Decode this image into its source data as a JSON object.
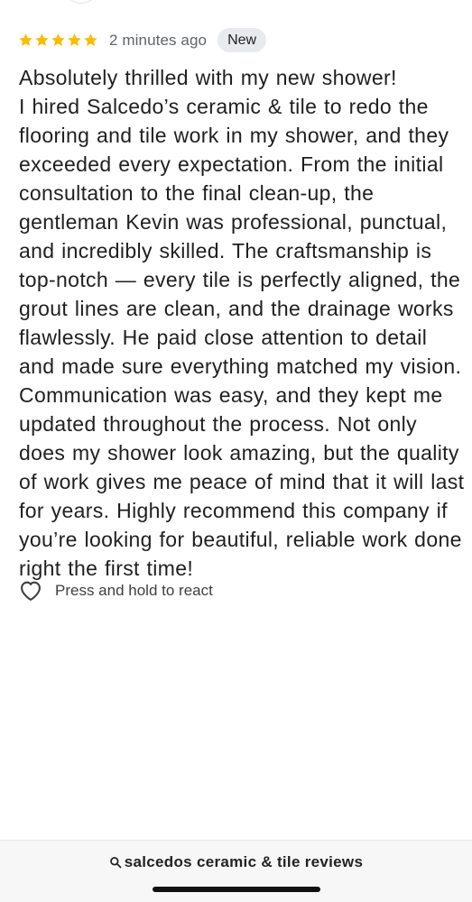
{
  "review": {
    "rating": 5,
    "rating_max": 5,
    "time": "2 minutes ago",
    "badge": "New",
    "paragraphs": [
      "Absolutely thrilled with my new shower!",
      "I hired Salcedo’s ceramic & tile to redo the flooring and tile work in my shower, and they exceeded every expectation. From the initial consultation to the final clean-up, the gentleman Kevin was professional, punctual, and incredibly skilled. The craftsmanship is top-notch — every tile is perfectly aligned, the grout lines are clean, and the drainage works flawlessly. He paid close attention to detail and made sure everything matched my vision.",
      "Communication was easy, and they kept me updated throughout the process. Not only does my shower look amazing, but the quality of work gives me peace of mind that it will last for years. Highly recommend this company if you’re looking for beautiful, reliable work done right the first time!"
    ]
  },
  "reaction": {
    "label": "Press and hold to react",
    "icon": "heart-icon"
  },
  "footer": {
    "search_text": "salcedos ceramic & tile reviews",
    "icon": "search-icon"
  },
  "colors": {
    "star": "#fbbc04",
    "badge_bg": "#e8eaed",
    "footer_bg": "#f7f7f7"
  }
}
